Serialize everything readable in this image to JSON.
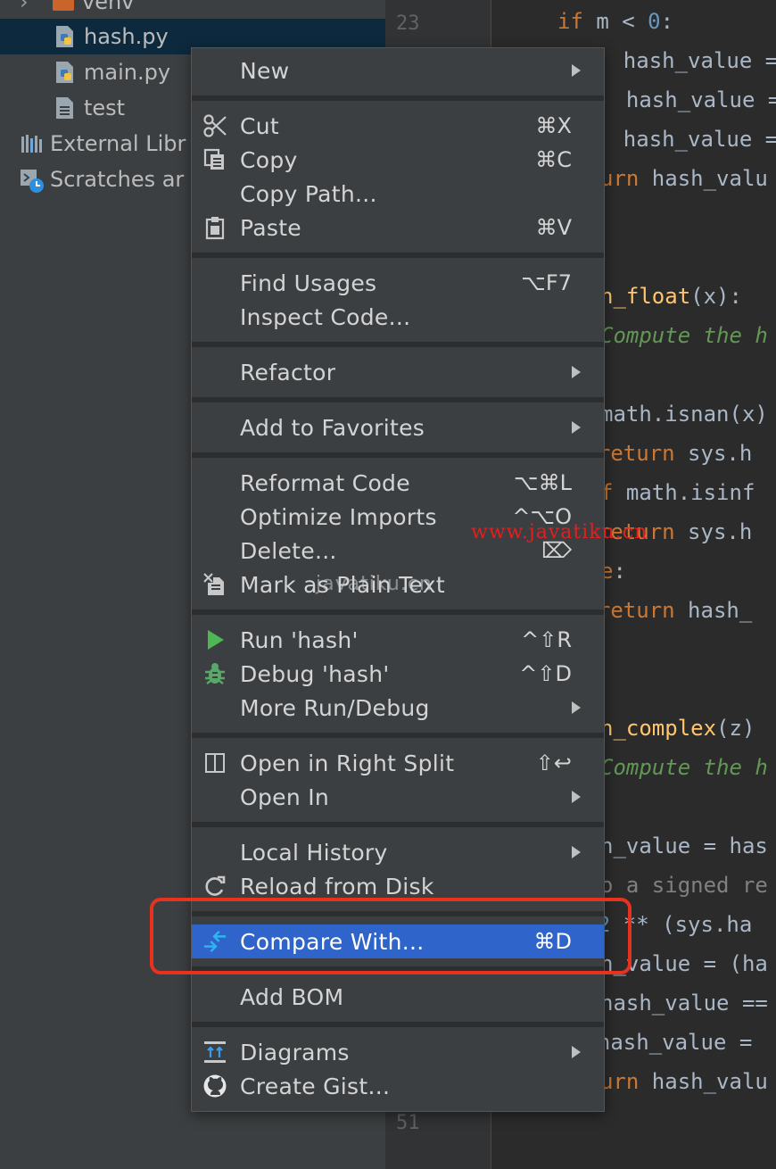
{
  "tree": {
    "items": [
      {
        "label": "venv",
        "icon": "folder-icon"
      },
      {
        "label": "hash.py",
        "icon": "python-file-icon"
      },
      {
        "label": "main.py",
        "icon": "python-file-icon"
      },
      {
        "label": "test",
        "icon": "text-file-icon"
      },
      {
        "label": "External Libr",
        "icon": "library-icon"
      },
      {
        "label": "Scratches ar",
        "icon": "scratches-icon"
      }
    ]
  },
  "gutter": {
    "line_numbers": [
      "23",
      "51"
    ]
  },
  "editor": {
    "lines": [
      [
        {
          "t": "if",
          "c": "kw"
        },
        {
          "t": " m < ",
          "c": ""
        },
        {
          "t": "0",
          "c": "num"
        },
        {
          "t": ":",
          "c": ""
        }
      ],
      [
        {
          "t": "    hash_value =",
          "c": ""
        }
      ],
      [
        {
          "t": "  hash_value ==",
          "c": ""
        }
      ],
      [
        {
          "t": "    hash_value =",
          "c": ""
        }
      ],
      [
        {
          "t": "urn",
          "c": "kw"
        },
        {
          "t": " hash_valu",
          "c": ""
        }
      ],
      [
        {
          "t": "h_float",
          "c": "fn"
        },
        {
          "t": "(x):",
          "c": ""
        }
      ],
      [
        {
          "t": "Compute the h",
          "c": "cm"
        }
      ],
      [
        {
          "t": "math.isnan(x)",
          "c": ""
        }
      ],
      [
        {
          "t": "  return",
          "c": "kw"
        },
        {
          "t": " sys.h",
          "c": ""
        }
      ],
      [
        {
          "t": "f",
          "c": "kw"
        },
        {
          "t": " math.isinf",
          "c": ""
        }
      ],
      [
        {
          "t": "  return",
          "c": "kw"
        },
        {
          "t": " sys.h",
          "c": ""
        }
      ],
      [
        {
          "t": "e",
          "c": "kw"
        },
        {
          "t": ":",
          "c": ""
        }
      ],
      [
        {
          "t": "  return",
          "c": "kw"
        },
        {
          "t": " hash_",
          "c": ""
        }
      ],
      [
        {
          "t": "h_complex",
          "c": "fn"
        },
        {
          "t": "(z)",
          "c": ""
        }
      ],
      [
        {
          "t": "Compute the h",
          "c": "cm"
        }
      ],
      [
        {
          "t": "h_value = has",
          "c": ""
        }
      ],
      [
        {
          "t": "o a signed re",
          "c": "gr"
        }
      ],
      [
        {
          "t": "  ",
          "c": ""
        },
        {
          "t": "2",
          "c": "num"
        },
        {
          "t": " ** (sys.ha",
          "c": ""
        }
      ],
      [
        {
          "t": "h_value = (ha",
          "c": ""
        }
      ],
      [
        {
          "t": "hash_value ==",
          "c": ""
        }
      ],
      [
        {
          "t": "  hash_value =",
          "c": ""
        }
      ],
      [
        {
          "t": "urn",
          "c": "kw"
        },
        {
          "t": " hash_valu",
          "c": ""
        }
      ]
    ]
  },
  "menu": {
    "items": [
      {
        "id": "new",
        "label": "New",
        "submenu": true
      },
      {
        "id": "cut",
        "label": "Cut",
        "shortcut": "⌘X",
        "icon": "scissors-icon"
      },
      {
        "id": "copy",
        "label": "Copy",
        "shortcut": "⌘C",
        "icon": "copy-icon"
      },
      {
        "id": "copy-path",
        "label": "Copy Path..."
      },
      {
        "id": "paste",
        "label": "Paste",
        "shortcut": "⌘V",
        "icon": "clipboard-icon"
      },
      {
        "id": "find-usages",
        "label": "Find Usages",
        "shortcut": "⌥F7"
      },
      {
        "id": "inspect-code",
        "label": "Inspect Code..."
      },
      {
        "id": "refactor",
        "label": "Refactor",
        "submenu": true
      },
      {
        "id": "add-to-favorites",
        "label": "Add to Favorites",
        "submenu": true
      },
      {
        "id": "reformat-code",
        "label": "Reformat Code",
        "shortcut": "⌥⌘L"
      },
      {
        "id": "optimize-imports",
        "label": "Optimize Imports",
        "shortcut": "^⌥O"
      },
      {
        "id": "delete",
        "label": "Delete...",
        "shortcut": "⌦"
      },
      {
        "id": "mark-plain-text",
        "label": "Mark as Plain Text",
        "icon": "plain-text-icon"
      },
      {
        "id": "run",
        "label": "Run 'hash'",
        "shortcut": "^⇧R",
        "icon": "run-icon"
      },
      {
        "id": "debug",
        "label": "Debug 'hash'",
        "shortcut": "^⇧D",
        "icon": "debug-icon"
      },
      {
        "id": "more-run-debug",
        "label": "More Run/Debug",
        "submenu": true
      },
      {
        "id": "open-right-split",
        "label": "Open in Right Split",
        "shortcut": "⇧↩",
        "icon": "split-icon"
      },
      {
        "id": "open-in",
        "label": "Open In",
        "submenu": true
      },
      {
        "id": "local-history",
        "label": "Local History",
        "submenu": true
      },
      {
        "id": "reload-from-disk",
        "label": "Reload from Disk",
        "icon": "reload-icon"
      },
      {
        "id": "compare-with",
        "label": "Compare With...",
        "shortcut": "⌘D",
        "icon": "compare-icon",
        "highlighted": true
      },
      {
        "id": "add-bom",
        "label": "Add BOM"
      },
      {
        "id": "diagrams",
        "label": "Diagrams",
        "submenu": true,
        "icon": "diagram-icon"
      },
      {
        "id": "create-gist",
        "label": "Create Gist...",
        "icon": "github-icon"
      }
    ]
  },
  "watermarks": {
    "url": "www.javatiku.cn",
    "text": "javatiku.cn"
  },
  "colors": {
    "highlight": "#2f65ca",
    "annotation": "#e8321e",
    "run": "#4eb655",
    "debug": "#59a869"
  }
}
